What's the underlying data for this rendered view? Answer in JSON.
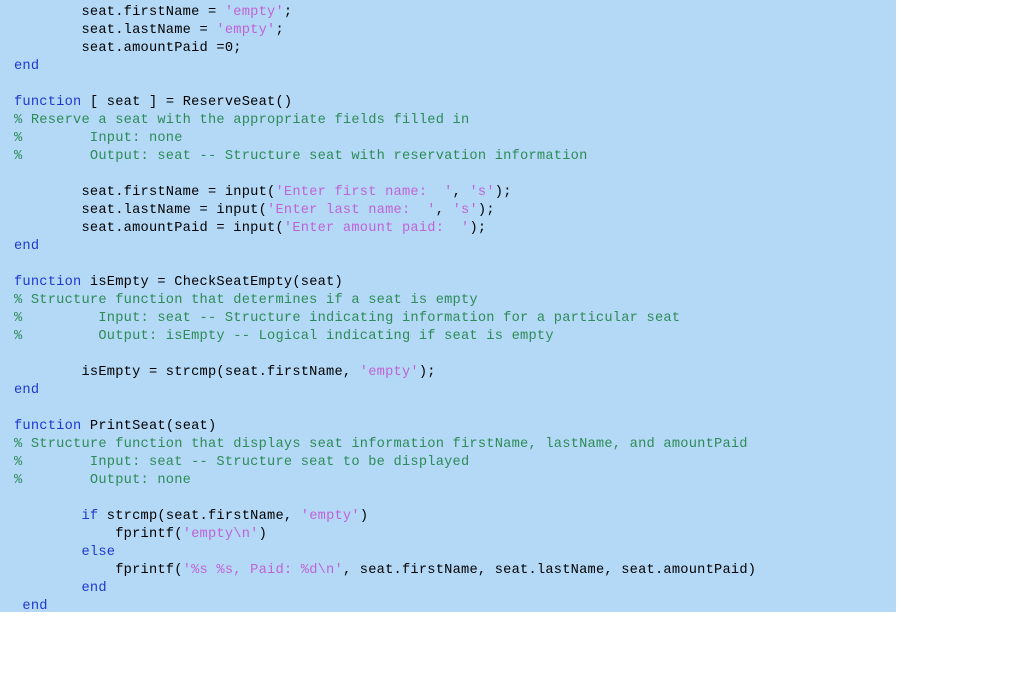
{
  "window": {
    "background_color": "#ffffff",
    "code_block_background": "#b3d9f7"
  },
  "syntax_colors": {
    "keyword": "#2038cf",
    "comment": "#2e8b57",
    "string": "#c063d6",
    "plain": "#000000"
  },
  "code_listing": {
    "language": "MATLAB",
    "line_count": 33,
    "lines": [
      {
        "id": 1,
        "indent": 8,
        "tokens": [
          {
            "t": "plain",
            "s": "seat.firstName = "
          },
          {
            "t": "string",
            "s": "'empty'"
          },
          {
            "t": "plain",
            "s": ";"
          }
        ]
      },
      {
        "id": 2,
        "indent": 8,
        "tokens": [
          {
            "t": "plain",
            "s": "seat.lastName = "
          },
          {
            "t": "string",
            "s": "'empty'"
          },
          {
            "t": "plain",
            "s": ";"
          }
        ]
      },
      {
        "id": 3,
        "indent": 8,
        "tokens": [
          {
            "t": "plain",
            "s": "seat.amountPaid =0;"
          }
        ]
      },
      {
        "id": 4,
        "indent": 0,
        "tokens": [
          {
            "t": "keyword",
            "s": "end"
          }
        ]
      },
      {
        "id": 5,
        "indent": 0,
        "tokens": [
          {
            "t": "plain",
            "s": ""
          }
        ]
      },
      {
        "id": 6,
        "indent": 0,
        "tokens": [
          {
            "t": "keyword",
            "s": "function"
          },
          {
            "t": "plain",
            "s": " [ seat ] = ReserveSeat()"
          }
        ]
      },
      {
        "id": 7,
        "indent": 0,
        "tokens": [
          {
            "t": "comment",
            "s": "% Reserve a seat with the appropriate fields filled in"
          }
        ]
      },
      {
        "id": 8,
        "indent": 0,
        "tokens": [
          {
            "t": "comment",
            "s": "%        Input: none"
          }
        ]
      },
      {
        "id": 9,
        "indent": 0,
        "tokens": [
          {
            "t": "comment",
            "s": "%        Output: seat -- Structure seat with reservation information"
          }
        ]
      },
      {
        "id": 10,
        "indent": 0,
        "tokens": [
          {
            "t": "plain",
            "s": ""
          }
        ]
      },
      {
        "id": 11,
        "indent": 8,
        "tokens": [
          {
            "t": "plain",
            "s": "seat.firstName = input("
          },
          {
            "t": "string",
            "s": "'Enter first name:  '"
          },
          {
            "t": "plain",
            "s": ", "
          },
          {
            "t": "string",
            "s": "'s'"
          },
          {
            "t": "plain",
            "s": ");"
          }
        ]
      },
      {
        "id": 12,
        "indent": 8,
        "tokens": [
          {
            "t": "plain",
            "s": "seat.lastName = input("
          },
          {
            "t": "string",
            "s": "'Enter last name:  '"
          },
          {
            "t": "plain",
            "s": ", "
          },
          {
            "t": "string",
            "s": "'s'"
          },
          {
            "t": "plain",
            "s": ");"
          }
        ]
      },
      {
        "id": 13,
        "indent": 8,
        "tokens": [
          {
            "t": "plain",
            "s": "seat.amountPaid = input("
          },
          {
            "t": "string",
            "s": "'Enter amount paid:  '"
          },
          {
            "t": "plain",
            "s": ");"
          }
        ]
      },
      {
        "id": 14,
        "indent": 0,
        "tokens": [
          {
            "t": "keyword",
            "s": "end"
          }
        ]
      },
      {
        "id": 15,
        "indent": 0,
        "tokens": [
          {
            "t": "plain",
            "s": ""
          }
        ]
      },
      {
        "id": 16,
        "indent": 0,
        "tokens": [
          {
            "t": "keyword",
            "s": "function"
          },
          {
            "t": "plain",
            "s": " isEmpty = CheckSeatEmpty(seat)"
          }
        ]
      },
      {
        "id": 17,
        "indent": 0,
        "tokens": [
          {
            "t": "comment",
            "s": "% Structure function that determines if a seat is empty"
          }
        ]
      },
      {
        "id": 18,
        "indent": 0,
        "tokens": [
          {
            "t": "comment",
            "s": "%         Input: seat -- Structure indicating information for a particular seat"
          }
        ]
      },
      {
        "id": 19,
        "indent": 0,
        "tokens": [
          {
            "t": "comment",
            "s": "%         Output: isEmpty -- Logical indicating if seat is empty"
          }
        ]
      },
      {
        "id": 20,
        "indent": 0,
        "tokens": [
          {
            "t": "plain",
            "s": ""
          }
        ]
      },
      {
        "id": 21,
        "indent": 8,
        "tokens": [
          {
            "t": "plain",
            "s": "isEmpty = strcmp(seat.firstName, "
          },
          {
            "t": "string",
            "s": "'empty'"
          },
          {
            "t": "plain",
            "s": ");"
          }
        ]
      },
      {
        "id": 22,
        "indent": 0,
        "tokens": [
          {
            "t": "keyword",
            "s": "end"
          }
        ]
      },
      {
        "id": 23,
        "indent": 0,
        "tokens": [
          {
            "t": "plain",
            "s": ""
          }
        ]
      },
      {
        "id": 24,
        "indent": 0,
        "tokens": [
          {
            "t": "keyword",
            "s": "function"
          },
          {
            "t": "plain",
            "s": " PrintSeat(seat)"
          }
        ]
      },
      {
        "id": 25,
        "indent": 0,
        "tokens": [
          {
            "t": "comment",
            "s": "% Structure function that displays seat information firstName, lastName, and amountPaid"
          }
        ]
      },
      {
        "id": 26,
        "indent": 0,
        "tokens": [
          {
            "t": "comment",
            "s": "%        Input: seat -- Structure seat to be displayed"
          }
        ]
      },
      {
        "id": 27,
        "indent": 0,
        "tokens": [
          {
            "t": "comment",
            "s": "%        Output: none"
          }
        ]
      },
      {
        "id": 28,
        "indent": 0,
        "tokens": [
          {
            "t": "plain",
            "s": ""
          }
        ]
      },
      {
        "id": 29,
        "indent": 8,
        "tokens": [
          {
            "t": "keyword",
            "s": "if"
          },
          {
            "t": "plain",
            "s": " strcmp(seat.firstName, "
          },
          {
            "t": "string",
            "s": "'empty'"
          },
          {
            "t": "plain",
            "s": ")"
          }
        ]
      },
      {
        "id": 30,
        "indent": 12,
        "tokens": [
          {
            "t": "plain",
            "s": "fprintf("
          },
          {
            "t": "string",
            "s": "'empty\\n'"
          },
          {
            "t": "plain",
            "s": ")"
          }
        ]
      },
      {
        "id": 31,
        "indent": 8,
        "tokens": [
          {
            "t": "keyword",
            "s": "else"
          }
        ]
      },
      {
        "id": 32,
        "indent": 12,
        "tokens": [
          {
            "t": "plain",
            "s": "fprintf("
          },
          {
            "t": "string",
            "s": "'%s %s, Paid: %d\\n'"
          },
          {
            "t": "plain",
            "s": ", seat.firstName, seat.lastName, seat.amountPaid)"
          }
        ]
      },
      {
        "id": 33,
        "indent": 8,
        "tokens": [
          {
            "t": "keyword",
            "s": "end"
          }
        ]
      },
      {
        "id": 34,
        "indent": 1,
        "tokens": [
          {
            "t": "keyword",
            "s": "end"
          }
        ]
      }
    ]
  }
}
